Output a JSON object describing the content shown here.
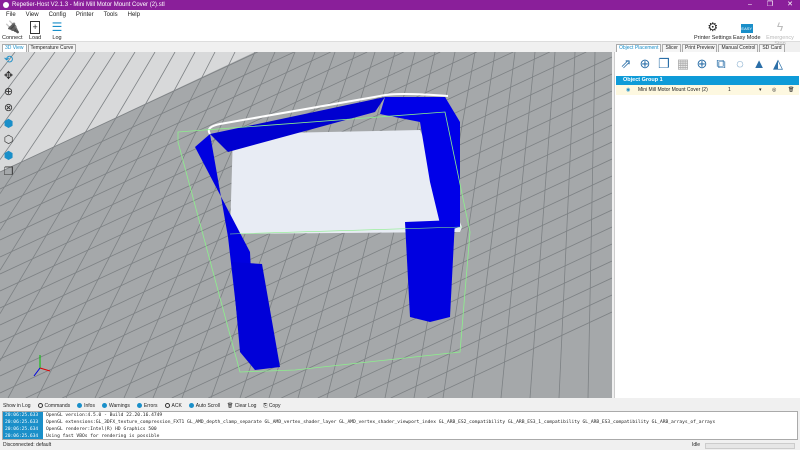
{
  "window": {
    "title": "Repetier-Host V2.1.3 - Mini Mill Motor Mount Cover (2).stl",
    "minimize": "–",
    "maximize": "❐",
    "close": "✕"
  },
  "menu": [
    "File",
    "View",
    "Config",
    "Printer",
    "Tools",
    "Help"
  ],
  "toolbar": {
    "connect": "Connect",
    "load": "Load",
    "log": "Log",
    "printer_settings": "Printer Settings",
    "easy_mode": "Easy Mode",
    "easy_badge": "EASY",
    "emergency_stop": "Emergency Stop"
  },
  "view_tabs": [
    "3D View",
    "Temperature Curve"
  ],
  "right_tabs": [
    "Object Placement",
    "Slicer",
    "Print Preview",
    "Manual Control",
    "SD Card"
  ],
  "object_group": "Object Group 1",
  "objects": [
    {
      "name": "Mini Mill Motor Mount Cover (2)",
      "count": "1"
    }
  ],
  "log_filters": {
    "label": "Show in Log",
    "items": [
      "Commands",
      "Infos",
      "Warnings",
      "Errors",
      "ACK",
      "Auto Scroll"
    ],
    "clear": "Clear Log",
    "copy": "Copy"
  },
  "log": [
    {
      "time": "20:06:25.633",
      "text": "OpenGL version:4.5.0 - Build 22.20.16.4749"
    },
    {
      "time": "20:06:25.633",
      "text": "OpenGL extensions:GL_3DFX_texture_compression_FXT1 GL_AMD_depth_clamp_separate GL_AMD_vertex_shader_layer GL_AMD_vertex_shader_viewport_index GL_ARB_ES2_compatibility GL_ARB_ES3_1_compatibility GL_ARB_ES3_compatibility GL_ARB_arrays_of_arrays"
    },
    {
      "time": "20:06:25.634",
      "text": "OpenGL renderer:Intel(R) HD Graphics 500"
    },
    {
      "time": "20:06:25.634",
      "text": "Using fast VBOs for rendering is possible"
    }
  ],
  "status": {
    "left": "Disconnected: default",
    "right": "Idle"
  },
  "colors": {
    "title": "#8a1f9a",
    "accent": "#0e9bd8",
    "model": "#0000e0"
  }
}
